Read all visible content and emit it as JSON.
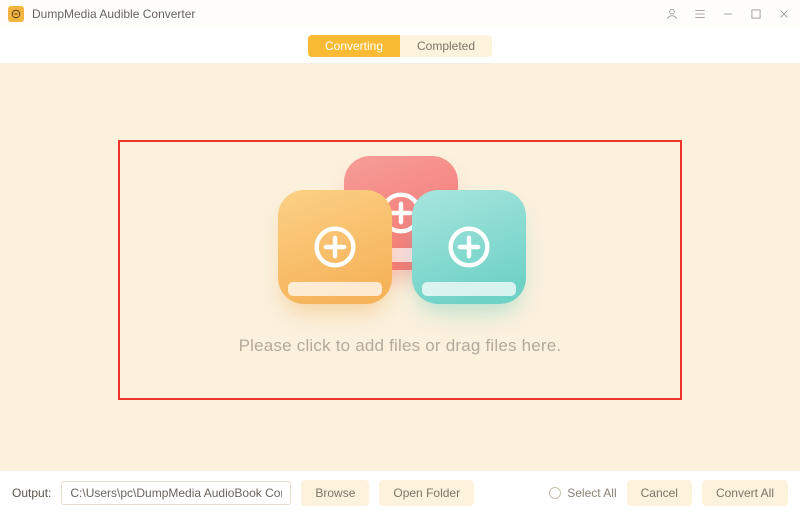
{
  "titlebar": {
    "app_name": "DumpMedia Audible Converter"
  },
  "tabs": {
    "converting": "Converting",
    "completed": "Completed",
    "active": "converting"
  },
  "dropzone": {
    "hint": "Please click to add files or drag files here."
  },
  "footer": {
    "output_label": "Output:",
    "output_path": "C:\\Users\\pc\\DumpMedia AudioBook Converte",
    "browse": "Browse",
    "open_folder": "Open Folder",
    "select_all": "Select All",
    "cancel": "Cancel",
    "convert_all": "Convert All"
  }
}
